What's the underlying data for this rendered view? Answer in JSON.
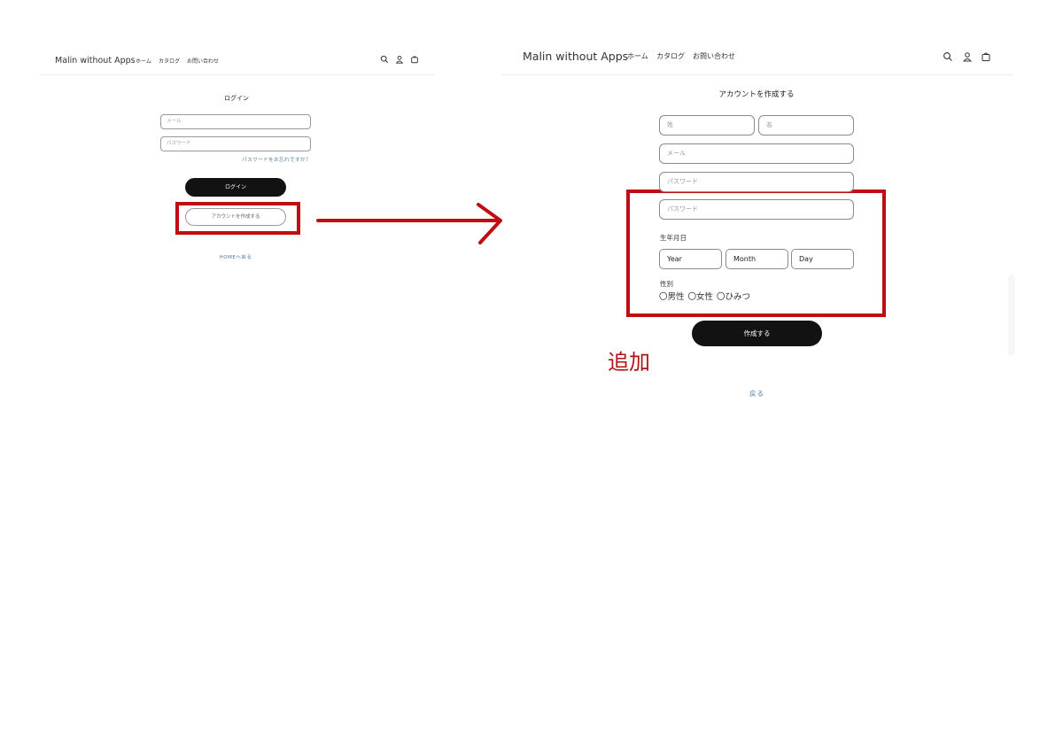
{
  "left": {
    "header": {
      "brand": "Malin without Apps",
      "nav": [
        "ホーム",
        "カタログ",
        "お問い合わせ"
      ],
      "icons": [
        "search-icon",
        "user-icon",
        "cart-icon"
      ]
    },
    "title": "ログイン",
    "email_placeholder": "メール",
    "password_placeholder": "パスワード",
    "forgot_password": "パスワードをお忘れですか？",
    "login_button": "ログイン",
    "create_account_button": "アカウントを作成する",
    "home_link": "HOMEへ戻る"
  },
  "right": {
    "header": {
      "brand": "Malin without Apps",
      "nav": [
        "ホーム",
        "カタログ",
        "お問い合わせ"
      ],
      "icons": [
        "search-icon",
        "user-icon",
        "cart-icon"
      ]
    },
    "title": "アカウントを作成する",
    "last_name_placeholder": "姓",
    "first_name_placeholder": "名",
    "email_placeholder": "メール",
    "password_placeholder": "パスワード",
    "password_confirm_placeholder": "パスワード",
    "birthdate_label": "生年月日",
    "birthdate_fields": [
      "Year",
      "Month",
      "Day"
    ],
    "gender_label": "性別",
    "gender_options": [
      "〇男性",
      "〇女性",
      "〇ひみつ"
    ],
    "submit_button": "作成する",
    "back_link": "戻る"
  },
  "annotation": {
    "added_label": "追加",
    "color": "#c00d12"
  }
}
